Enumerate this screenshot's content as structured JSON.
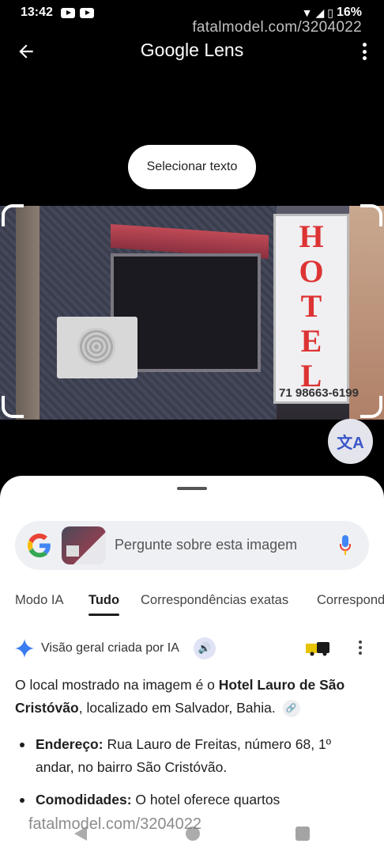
{
  "status_bar": {
    "time": "13:42",
    "battery": "16%"
  },
  "watermark": "fatalmodel.com/3204022",
  "header": {
    "title_google": "Google",
    "title_lens": "Lens"
  },
  "select_text_button": "Selecionar texto",
  "photo": {
    "sign_letters": [
      "H",
      "O",
      "T",
      "E",
      "L"
    ],
    "sign_phone": "71 98663-6199"
  },
  "search": {
    "placeholder": "Pergunte sobre esta imagem"
  },
  "tabs": [
    {
      "label": "Modo IA",
      "active": false
    },
    {
      "label": "Tudo",
      "active": true
    },
    {
      "label": "Correspondências exatas",
      "active": false
    },
    {
      "label": "Correspondências",
      "active": false
    }
  ],
  "ai_overview": {
    "title": "Visão geral criada por IA",
    "intro_part1": "O local mostrado na imagem é o ",
    "intro_bold": "Hotel Lauro de São Cristóvão",
    "intro_part2": ", localizado em Salvador, Bahia.",
    "bullets": [
      {
        "label": "Endereço:",
        "text": " Rua Lauro de Freitas, número 68, 1º andar, no bairro São Cristóvão."
      },
      {
        "label": "Comodidades:",
        "text": " O hotel oferece quartos"
      }
    ]
  },
  "colors": {
    "accent_blue": "#3a56c8",
    "sign_red": "#dd3333"
  }
}
